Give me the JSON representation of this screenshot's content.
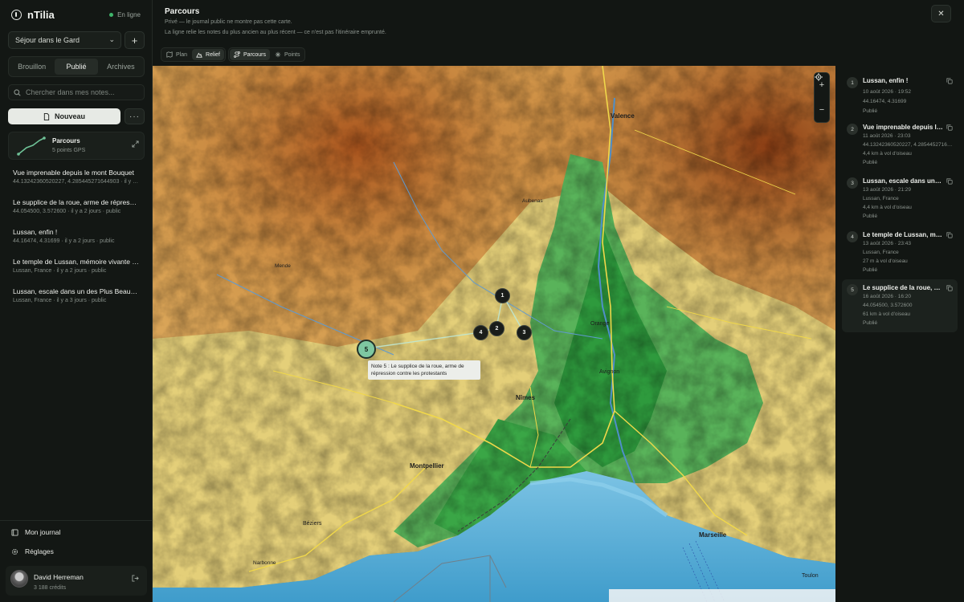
{
  "app": {
    "name": "nTilia",
    "status": "En ligne"
  },
  "sidebar": {
    "trip_select": "Séjour dans le Gard",
    "add_label": "+",
    "tabs": [
      {
        "label": "Brouillon",
        "active": false
      },
      {
        "label": "Publié",
        "active": true
      },
      {
        "label": "Archives",
        "active": false
      }
    ],
    "search_placeholder": "Chercher dans mes notes...",
    "new_label": "Nouveau",
    "more_label": "···",
    "route": {
      "title": "Parcours",
      "subtitle": "5 points GPS"
    },
    "notes": [
      {
        "title": "Vue imprenable depuis le mont Bouquet",
        "meta": "44.13242360520227, 4.285445271644903 · il y a 2 jours · public"
      },
      {
        "title": "Le supplice de la roue, arme de répressi...",
        "meta": "44.054500, 3.572600 · il y a 2 jours · public"
      },
      {
        "title": "Lussan, enfin !",
        "meta": "44.16474, 4.31699 · il y a 2 jours · public"
      },
      {
        "title": "Le temple de Lussan, mémoire vivante d...",
        "meta": "Lussan, France · il y a 2 jours · public"
      },
      {
        "title": "Lussan, escale dans un des Plus Beaux ...",
        "meta": "Lussan, France · il y a 3 jours · public"
      }
    ],
    "journal_label": "Mon journal",
    "settings_label": "Réglages",
    "user": {
      "name": "David Herreman",
      "credits": "3 188 crédits"
    }
  },
  "header": {
    "title": "Parcours",
    "subtitle1": "Privé — le journal public ne montre pas cette carte.",
    "subtitle2": "La ligne relie les notes du plus ancien au plus récent — ce n'est pas l'itinéraire emprunté.",
    "close_label": "✕",
    "base_layers": [
      {
        "label": "Plan",
        "active": false
      },
      {
        "label": "Relief",
        "active": true
      }
    ],
    "view_modes": [
      {
        "label": "Parcours",
        "active": true
      },
      {
        "label": "Points",
        "active": false
      }
    ]
  },
  "map": {
    "zoom_in": "+",
    "zoom_out": "−",
    "markers": [
      "1",
      "2",
      "3",
      "4",
      "5"
    ],
    "active_marker": "5",
    "tooltip": "Note 5 : Le supplice de la roue, arme de répression contre les protestants",
    "places": [
      "Valence",
      "Nîmes",
      "Montpellier",
      "Marseille",
      "Béziers",
      "Avignon",
      "Orange",
      "Narbonne",
      "Toulon",
      "Aubenas",
      "Mende"
    ]
  },
  "steps": [
    {
      "num": "1",
      "title": "Lussan, enfin !",
      "lines": [
        "10 août 2026 · 19:52",
        "44.16474, 4.31699",
        "Publié"
      ],
      "active": false
    },
    {
      "num": "2",
      "title": "Vue imprenable depuis le mont Bouquet",
      "lines": [
        "11 août 2026 · 23:03",
        "44.13242360520227, 4.285445271644903",
        "4,4 km à vol d'oiseau",
        "Publié"
      ],
      "active": false
    },
    {
      "num": "3",
      "title": "Lussan, escale dans un des Plus Beaux",
      "lines": [
        "13 août 2026 · 21:29",
        "Lussan, France",
        "4,4 km à vol d'oiseau",
        "Publié"
      ],
      "active": false
    },
    {
      "num": "4",
      "title": "Le temple de Lussan, mémoire vivante",
      "lines": [
        "13 août 2026 · 23:43",
        "Lussan, France",
        "27 m à vol d'oiseau",
        "Publié"
      ],
      "active": false
    },
    {
      "num": "5",
      "title": "Le supplice de la roue, arme de répression",
      "lines": [
        "16 août 2026 · 16:20",
        "44.054500, 3.572600",
        "61 km à vol d'oiseau",
        "Publié"
      ],
      "active": true
    }
  ]
}
